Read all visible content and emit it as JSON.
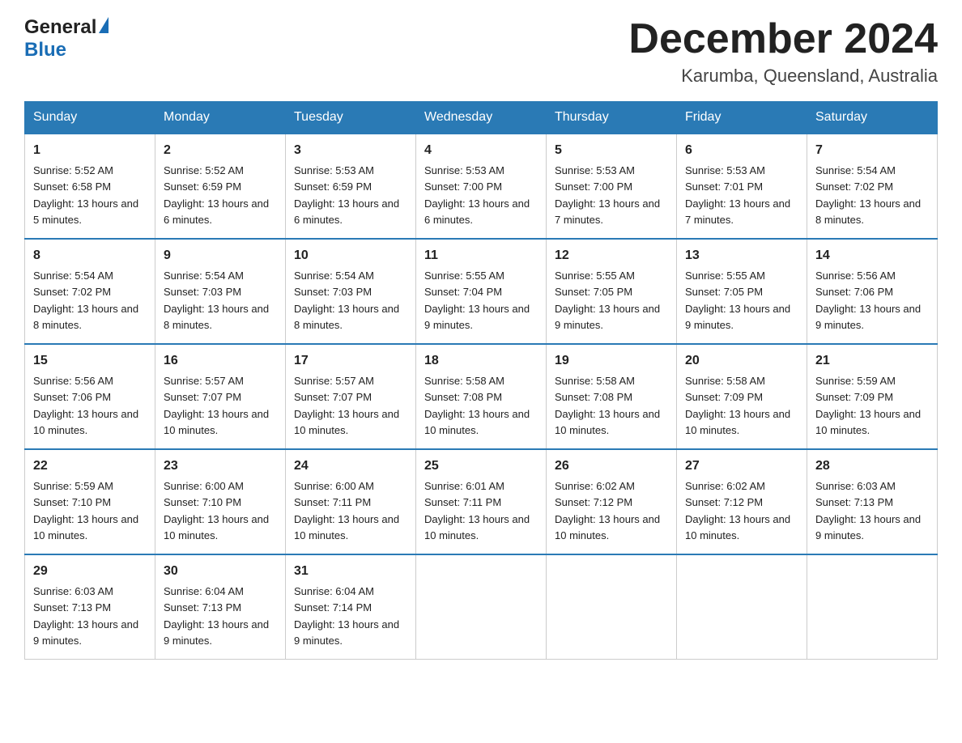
{
  "header": {
    "title": "December 2024",
    "subtitle": "Karumba, Queensland, Australia"
  },
  "logo": {
    "line1": "General",
    "line2": "Blue"
  },
  "days": [
    "Sunday",
    "Monday",
    "Tuesday",
    "Wednesday",
    "Thursday",
    "Friday",
    "Saturday"
  ],
  "weeks": [
    [
      {
        "num": "1",
        "sunrise": "5:52 AM",
        "sunset": "6:58 PM",
        "daylight": "13 hours and 5 minutes."
      },
      {
        "num": "2",
        "sunrise": "5:52 AM",
        "sunset": "6:59 PM",
        "daylight": "13 hours and 6 minutes."
      },
      {
        "num": "3",
        "sunrise": "5:53 AM",
        "sunset": "6:59 PM",
        "daylight": "13 hours and 6 minutes."
      },
      {
        "num": "4",
        "sunrise": "5:53 AM",
        "sunset": "7:00 PM",
        "daylight": "13 hours and 6 minutes."
      },
      {
        "num": "5",
        "sunrise": "5:53 AM",
        "sunset": "7:00 PM",
        "daylight": "13 hours and 7 minutes."
      },
      {
        "num": "6",
        "sunrise": "5:53 AM",
        "sunset": "7:01 PM",
        "daylight": "13 hours and 7 minutes."
      },
      {
        "num": "7",
        "sunrise": "5:54 AM",
        "sunset": "7:02 PM",
        "daylight": "13 hours and 8 minutes."
      }
    ],
    [
      {
        "num": "8",
        "sunrise": "5:54 AM",
        "sunset": "7:02 PM",
        "daylight": "13 hours and 8 minutes."
      },
      {
        "num": "9",
        "sunrise": "5:54 AM",
        "sunset": "7:03 PM",
        "daylight": "13 hours and 8 minutes."
      },
      {
        "num": "10",
        "sunrise": "5:54 AM",
        "sunset": "7:03 PM",
        "daylight": "13 hours and 8 minutes."
      },
      {
        "num": "11",
        "sunrise": "5:55 AM",
        "sunset": "7:04 PM",
        "daylight": "13 hours and 9 minutes."
      },
      {
        "num": "12",
        "sunrise": "5:55 AM",
        "sunset": "7:05 PM",
        "daylight": "13 hours and 9 minutes."
      },
      {
        "num": "13",
        "sunrise": "5:55 AM",
        "sunset": "7:05 PM",
        "daylight": "13 hours and 9 minutes."
      },
      {
        "num": "14",
        "sunrise": "5:56 AM",
        "sunset": "7:06 PM",
        "daylight": "13 hours and 9 minutes."
      }
    ],
    [
      {
        "num": "15",
        "sunrise": "5:56 AM",
        "sunset": "7:06 PM",
        "daylight": "13 hours and 10 minutes."
      },
      {
        "num": "16",
        "sunrise": "5:57 AM",
        "sunset": "7:07 PM",
        "daylight": "13 hours and 10 minutes."
      },
      {
        "num": "17",
        "sunrise": "5:57 AM",
        "sunset": "7:07 PM",
        "daylight": "13 hours and 10 minutes."
      },
      {
        "num": "18",
        "sunrise": "5:58 AM",
        "sunset": "7:08 PM",
        "daylight": "13 hours and 10 minutes."
      },
      {
        "num": "19",
        "sunrise": "5:58 AM",
        "sunset": "7:08 PM",
        "daylight": "13 hours and 10 minutes."
      },
      {
        "num": "20",
        "sunrise": "5:58 AM",
        "sunset": "7:09 PM",
        "daylight": "13 hours and 10 minutes."
      },
      {
        "num": "21",
        "sunrise": "5:59 AM",
        "sunset": "7:09 PM",
        "daylight": "13 hours and 10 minutes."
      }
    ],
    [
      {
        "num": "22",
        "sunrise": "5:59 AM",
        "sunset": "7:10 PM",
        "daylight": "13 hours and 10 minutes."
      },
      {
        "num": "23",
        "sunrise": "6:00 AM",
        "sunset": "7:10 PM",
        "daylight": "13 hours and 10 minutes."
      },
      {
        "num": "24",
        "sunrise": "6:00 AM",
        "sunset": "7:11 PM",
        "daylight": "13 hours and 10 minutes."
      },
      {
        "num": "25",
        "sunrise": "6:01 AM",
        "sunset": "7:11 PM",
        "daylight": "13 hours and 10 minutes."
      },
      {
        "num": "26",
        "sunrise": "6:02 AM",
        "sunset": "7:12 PM",
        "daylight": "13 hours and 10 minutes."
      },
      {
        "num": "27",
        "sunrise": "6:02 AM",
        "sunset": "7:12 PM",
        "daylight": "13 hours and 10 minutes."
      },
      {
        "num": "28",
        "sunrise": "6:03 AM",
        "sunset": "7:13 PM",
        "daylight": "13 hours and 9 minutes."
      }
    ],
    [
      {
        "num": "29",
        "sunrise": "6:03 AM",
        "sunset": "7:13 PM",
        "daylight": "13 hours and 9 minutes."
      },
      {
        "num": "30",
        "sunrise": "6:04 AM",
        "sunset": "7:13 PM",
        "daylight": "13 hours and 9 minutes."
      },
      {
        "num": "31",
        "sunrise": "6:04 AM",
        "sunset": "7:14 PM",
        "daylight": "13 hours and 9 minutes."
      },
      null,
      null,
      null,
      null
    ]
  ],
  "labels": {
    "sunrise": "Sunrise:",
    "sunset": "Sunset:",
    "daylight": "Daylight:"
  }
}
